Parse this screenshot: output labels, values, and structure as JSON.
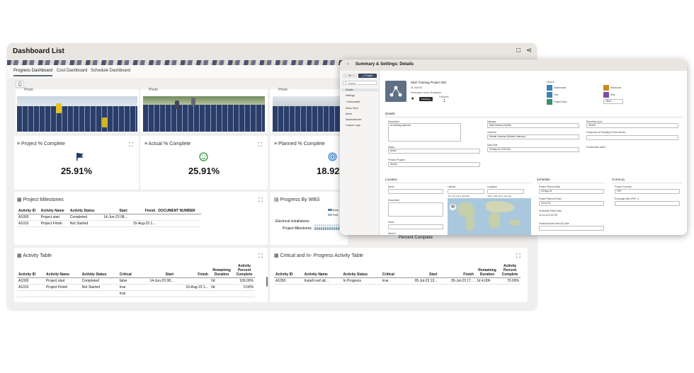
{
  "dashboard": {
    "title": "Dashboard List",
    "tabs": [
      "Progress Dashboard",
      "Cost Dashboard",
      "Schedule Dashboard"
    ],
    "photo_labels": [
      "Photo",
      "Photo",
      "Photo"
    ],
    "kpis": [
      {
        "title": "Project % Complete",
        "value": "25.91%",
        "icon": "flag-icon"
      },
      {
        "title": "Actual % Complete",
        "value": "25.91%",
        "icon": "smiley-icon"
      },
      {
        "title": "Planned % Complete",
        "value": "18.92",
        "icon": "target-icon"
      }
    ],
    "milestones": {
      "title": "Project Milestones",
      "columns": [
        "Activity ID",
        "Activity Name",
        "Activity Status",
        "Start",
        "Finish",
        "DOCUMENT NUMBER"
      ],
      "rows": [
        [
          "A1000",
          "Project start",
          "Completed",
          "14-Jun-23 08...",
          "",
          ""
        ],
        [
          "A1010",
          "Project Finish",
          "Not Started",
          "",
          "15-Aug-23 1...",
          ""
        ]
      ]
    },
    "wbs": {
      "title": "Progress By WBS",
      "labels": [
        "Electrical installations",
        "Project Milestones"
      ],
      "legend": [
        "Actu",
        "Perf"
      ],
      "xlabel": "Percent Complete"
    },
    "activity_table": {
      "title": "Activity Table",
      "columns": [
        "Activity ID",
        "Activity Name",
        "Activity Status",
        "Critical",
        "Start",
        "Finish",
        "Remaining Duration",
        "Activity Percent Complete"
      ],
      "rows": [
        [
          "A1000",
          "Project start",
          "Completed",
          "false",
          "14-Jun-23 08...",
          "",
          "0d",
          "100.00%"
        ],
        [
          "A1010",
          "Project Finish",
          "Not Started",
          "true",
          "",
          "15-Aug-23 1...",
          "0d",
          "0.00%"
        ],
        [
          "",
          "",
          "",
          "true",
          "",
          "",
          "",
          ""
        ]
      ]
    },
    "critical_table": {
      "title": "Critical and In- Progress Activity Table",
      "columns": [
        "Activity ID",
        "Activity Name",
        "Activity Status",
        "Critical",
        "Start",
        "Finish",
        "Remaining Duration",
        "Activity Percent Complete"
      ],
      "rows": [
        [
          "A1050",
          "Install roof att...",
          "In Progress",
          "true",
          "05-Jul-23 13...",
          "05-Jul-23 17...",
          "1d 4.00h",
          "70.00%"
        ]
      ]
    }
  },
  "overlay": {
    "title": "Summary & Settings: Details",
    "project_badge": "Project",
    "search_placeholder": "Search",
    "sidebar": [
      "Details",
      "Settings",
      "Dictionaries",
      "News Feed",
      "Alerts",
      "Dependencies",
      "Custom Logs"
    ],
    "project_name": "MLE Training Project 001",
    "project_id": "ID: MLE001",
    "workspace": "Workspace: Demo Workspace",
    "following": "Following",
    "followers_label": "Followers",
    "followers_count": "1",
    "open_in_label": "Open in",
    "open_in": [
      "Dashboards",
      "Resources",
      "Files",
      "Risk",
      "Project Team",
      "Other..."
    ],
    "details_heading": "Details",
    "fields": {
      "description_label": "Description",
      "description_value": "for training purposes",
      "manager_label": "Manager",
      "manager_value": "Mark Anthony Espiritu",
      "calendar_label": "Calendar",
      "calendar_value": "Default Calendar (Default Calendar)",
      "reporting_cycle_label": "Reporting Cycle",
      "reporting_cycle_value": "Search",
      "freq_label": "Frequency for Resetting Period Names",
      "data_date_label": "Data Date",
      "data_date_value": "29-May-24 12:00 AM",
      "construction_label": "Construction Value",
      "status_label": "Status",
      "status_value": "Active",
      "primary_program_label": "Primary Program",
      "primary_program_value": "Search"
    },
    "location_heading": "Location",
    "location": {
      "name_label": "Name",
      "latitude_label": "Latitude",
      "longitude_label": "Longitude",
      "lat_hint": "-90 to 90 with 6 decimals",
      "lon_hint": "-180 to 180 with 6 decimals",
      "description_label": "Description",
      "street_label": "Street",
      "street2_label": "Street 2"
    },
    "schedule_heading": "Schedule",
    "schedule": {
      "planned_start_label": "Project Planned Start",
      "planned_start_value": "29-May-24",
      "planned_finish_label": "Project Planned Finish",
      "planned_finish_value": "30-Jul-24",
      "sched_finish_label": "Scheduled Finish Date",
      "sched_finish_value": "30-Jul-24 5:00 PM",
      "must_finish_label": "Schedule Must Finish By Date"
    },
    "currency_heading": "Currency",
    "currency": {
      "project_currency_label": "Project Currency",
      "project_currency_value": "PHP",
      "exchange_label": "Exchange Rate (PHP =)"
    }
  }
}
